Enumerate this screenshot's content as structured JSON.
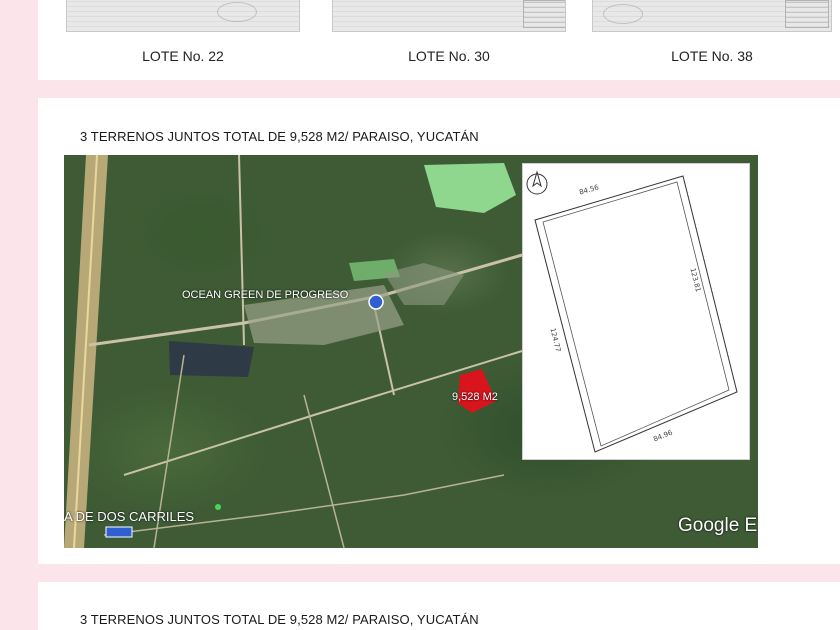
{
  "top_card": {
    "lots": [
      {
        "label": "LOTE No. 22"
      },
      {
        "label": "LOTE No. 30"
      },
      {
        "label": "LOTE No. 38"
      }
    ]
  },
  "main_card": {
    "heading": "3 TERRENOS JUNTOS TOTAL DE 9,528 M2/ PARAISO, YUCATÁN",
    "map": {
      "place_label": "OCEAN GREEN DE PROGRESO",
      "road_label": "A DE DOS CARRILES",
      "parcel_label": "9,528 M2",
      "watermark": "Google E",
      "parcel_color": "#d8141c",
      "diagram": {
        "side_top": "84.56",
        "side_right": "123.81",
        "side_left": "124.77",
        "side_bottom": "84.96"
      }
    }
  },
  "bottom_card": {
    "heading": "3 TERRENOS JUNTOS TOTAL DE 9,528 M2/ PARAISO, YUCATÁN"
  }
}
